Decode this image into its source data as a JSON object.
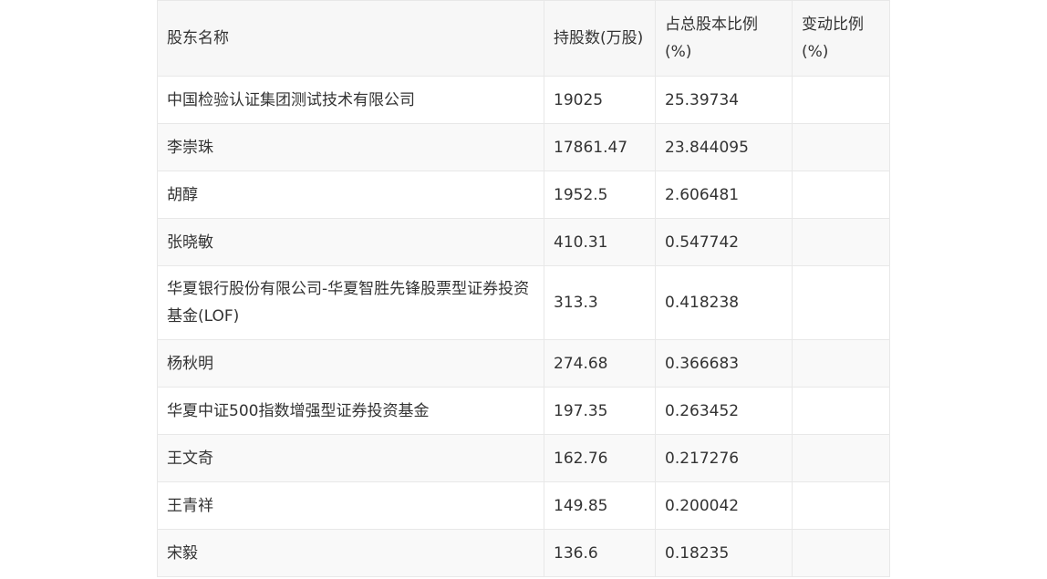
{
  "table": {
    "headers": [
      "股东名称",
      "持股数(万股)",
      "占总股本比例(%)",
      "变动比例(%)"
    ],
    "rows": [
      [
        "中国检验认证集团测试技术有限公司",
        "19025",
        "25.39734",
        ""
      ],
      [
        "李崇珠",
        "17861.47",
        "23.844095",
        ""
      ],
      [
        "胡醇",
        "1952.5",
        "2.606481",
        ""
      ],
      [
        "张晓敏",
        "410.31",
        "0.547742",
        ""
      ],
      [
        "华夏银行股份有限公司-华夏智胜先锋股票型证券投资基金(LOF)",
        "313.3",
        "0.418238",
        ""
      ],
      [
        "杨秋明",
        "274.68",
        "0.366683",
        ""
      ],
      [
        "华夏中证500指数增强型证券投资基金",
        "197.35",
        "0.263452",
        ""
      ],
      [
        "王文奇",
        "162.76",
        "0.217276",
        ""
      ],
      [
        "王青祥",
        "149.85",
        "0.200042",
        ""
      ],
      [
        "宋毅",
        "136.6",
        "0.18235",
        ""
      ]
    ]
  }
}
